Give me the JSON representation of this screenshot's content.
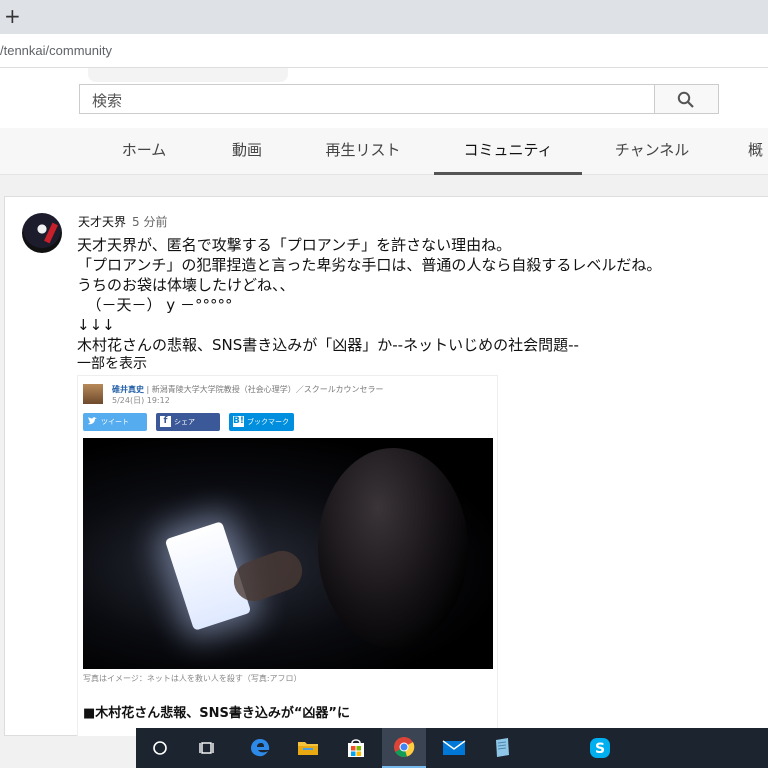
{
  "browser": {
    "newtab_symbol": "+",
    "url": "/tennkai/community"
  },
  "search": {
    "placeholder": "検索"
  },
  "nav": {
    "tabs": [
      "ホーム",
      "動画",
      "再生リスト",
      "コミュニティ",
      "チャンネル",
      "概"
    ],
    "active": "コミュニティ"
  },
  "post": {
    "author": "天才天界",
    "time": "5 分前",
    "lines": [
      "天才天界が、匿名で攻撃する「プロアンチ」を許さない理由ね。",
      "「プロアンチ」の犯罪捏造と言った卑劣な手口は、普通の人なら自殺するレベルだね。",
      "うちのお袋は体壊したけどね、、",
      "  （－天－） y －°°°°°",
      "↓↓↓",
      "木村花さんの悲報、SNS書き込みが「凶器」か--ネットいじめの社会問題--"
    ],
    "show_more": "一部を表示",
    "attachment": {
      "author_name": "碓井真史",
      "author_title": "新潟青陵大学大学院教授（社会心理学）／スクールカウンセラー",
      "date": "5/24(日) 19:12",
      "share_buttons": [
        {
          "label": "ツイート",
          "icon": "twitter-icon",
          "color": "#55acee"
        },
        {
          "label": "シェア",
          "icon": "facebook-icon",
          "color": "#3b5998"
        },
        {
          "label": "ブックマーク",
          "icon": "hatena-bookmark-icon",
          "color": "#008fde"
        }
      ],
      "caption": "写真はイメージ：ネットは人を救い人を殺す（写真:アフロ）",
      "headline": "■木村花さん悲報、SNS書き込みが“凶器”に"
    }
  },
  "taskbar": {
    "apps": [
      "cortana-search",
      "task-view",
      "edge",
      "file-explorer",
      "store",
      "chrome",
      "mail",
      "notepad",
      "skype"
    ],
    "active": "chrome"
  }
}
